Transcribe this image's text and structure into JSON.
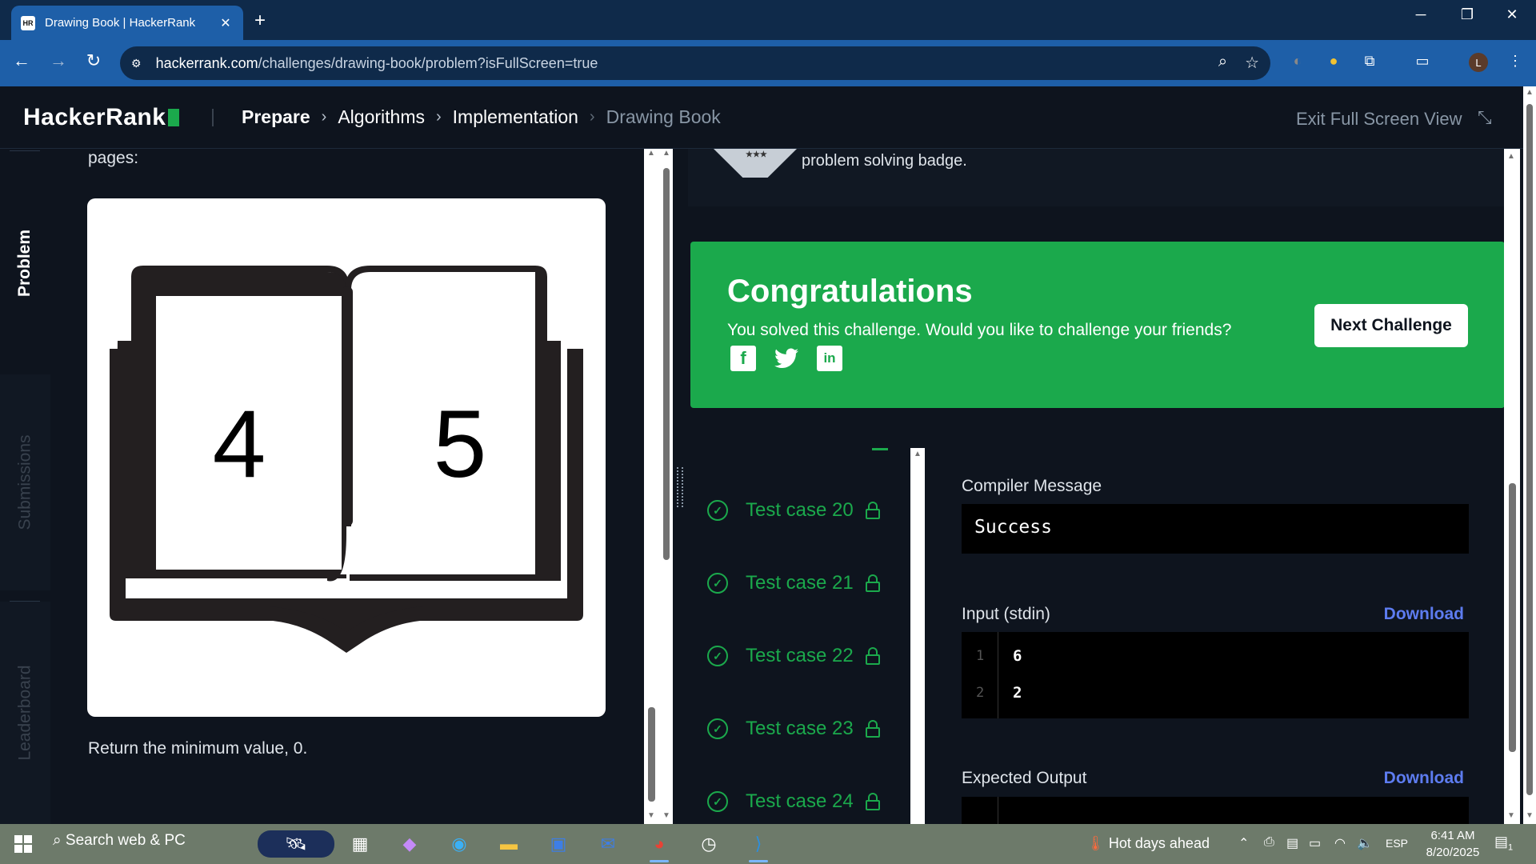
{
  "browser": {
    "tab_title": "Drawing Book | HackerRank",
    "tab_favicon": "HR",
    "url_host": "hackerrank.com",
    "url_path": "/challenges/drawing-book/problem?isFullScreen=true",
    "profile_initial": "L"
  },
  "header": {
    "logo": "HackerRank",
    "breadcrumbs": [
      "Prepare",
      "Algorithms",
      "Implementation",
      "Drawing Book"
    ],
    "exit_fullscreen": "Exit Full Screen View"
  },
  "side_tabs": [
    "Problem",
    "Submissions",
    "Leaderboard"
  ],
  "problem": {
    "pages_text": "pages:",
    "book_left_page": "4",
    "book_right_page": "5",
    "return_text": "Return the minimum value, 0."
  },
  "results": {
    "badge_text": "problem solving badge.",
    "congrats_title": "Congratulations",
    "congrats_sub": "You solved this challenge. Would you like to challenge your friends?",
    "next_button": "Next Challenge",
    "social": [
      "facebook-icon",
      "twitter-icon",
      "linkedin-icon"
    ],
    "test_cases": [
      "Test case 20",
      "Test case 21",
      "Test case 22",
      "Test case 23",
      "Test case 24"
    ],
    "compiler_label": "Compiler Message",
    "compiler_message": "Success",
    "input_label": "Input (stdin)",
    "download_label": "Download",
    "input_lines": [
      {
        "num": "1",
        "value": "6"
      },
      {
        "num": "2",
        "value": "2"
      }
    ],
    "expected_label": "Expected Output"
  },
  "taskbar": {
    "search_placeholder": "Search web & PC",
    "weather": "Hot days ahead",
    "language": "ESP",
    "time": "6:41 AM",
    "date": "8/20/2025",
    "notification_count": "1"
  },
  "colors": {
    "accent_green": "#1ba94c",
    "link_blue": "#5d7cf0",
    "page_bg": "#0e141e",
    "browser_blue": "#1e5fa8"
  }
}
